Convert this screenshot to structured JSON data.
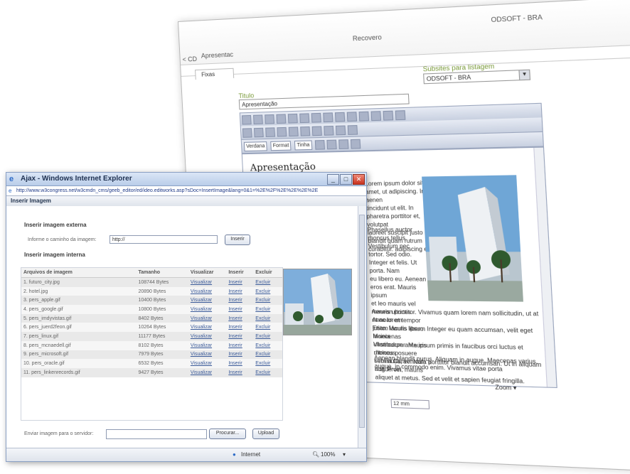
{
  "background_window": {
    "top_label": "ODSOFT - BRA",
    "center_label": "Recovero",
    "left_label_1": "< CD",
    "left_label_2": "Apresentac",
    "tab_label": "Fixas",
    "select_caption": "Subsites para listagem",
    "select_value": "ODSOFT - BRA",
    "title_caption": "Titulo",
    "title_value": "Apresentação",
    "font_select": "Verdana",
    "format_select": "Format",
    "size_select": "Tinha",
    "content_heading": "Apresentação",
    "para1": [
      "Lorem ipsum dolor sit amet, ut adipiscing. In aenen",
      "tincidunt ut elit. In pharetra porttitor et, volutpat",
      "laoreet suscipit justo blandit quam rutrum",
      "curabitur. adipiscing et"
    ],
    "para2": [
      "Phasellus auctor rhoncus tellus. Vestibulum nec",
      "tortor. Sed odio. Integer et felis. Ut porta. Nam",
      "eu libero eu. Aenean eros erat. Mauris ipsum",
      "et leo mauris vel mauris ultrices",
      "Aenean et tempor justo. Mauris ipsum",
      "Maecenas ullamcorper. Mauris rhoncus",
      "sem nulla, vehicula a augue vel, mauris"
    ],
    "para3": [
      "Aenean porttitor. Vivamus quam lorem nam sollicitudin, ut at et ac lorem",
      "Etiam iaculis libero. Integer eu quam accumsan, velit eget lacinia",
      "Vestibulum ante ipsum primis in faucibus orci luctus et ultrices posuere",
      "cubilia Curae. Nam porttitor blandit accumsan. Ut in aliquam nisl. Proin",
      "aliquet at metus. Sed et velit et sapien feugiat fringilla."
    ],
    "para4": [
      "Aenean blandit purus. Aliquam in augue. Maecenas varius,",
      "augue, in commodo enim. Vivamus vitae porta"
    ],
    "zoom_label": "Zoom ▾",
    "lower_field": "12 mm"
  },
  "popup": {
    "title": "Ajax - Windows Internet Explorer",
    "address": "http://www.w3congress.net/w3cmdn_cms/geeb_editor/ed/ideo.editworks.asp?sDoc=InsertImage&lang=0&1=%2E%2F%2E%2E%2E%2E",
    "header": "Inserir Imagem",
    "external_section": "Inserir imagem externa",
    "external_label": "Informe o caminho da imagem:",
    "external_value": "http://",
    "insert_button": "Inserir",
    "internal_section": "Inserir imagem interna",
    "columns": [
      "Arquivos de imagem",
      "Tamanho",
      "Visualizar",
      "Inserir",
      "Excluir"
    ],
    "rows": [
      {
        "file": "1. futuro_city.jpg",
        "size": "108744 Bytes",
        "view": "Visualizar",
        "insert": "Inserir",
        "delete": "Excluir"
      },
      {
        "file": "2. hotel.jpg",
        "size": "20890 Bytes",
        "view": "Visualizar",
        "insert": "Inserir",
        "delete": "Excluir"
      },
      {
        "file": "3. pers_apple.gif",
        "size": "10400 Bytes",
        "view": "Visualizar",
        "insert": "Inserir",
        "delete": "Excluir"
      },
      {
        "file": "4. pers_google.gif",
        "size": "10800 Bytes",
        "view": "Visualizar",
        "insert": "Inserir",
        "delete": "Excluir"
      },
      {
        "file": "5. pers_imdyvistas.gif",
        "size": "8402 Bytes",
        "view": "Visualizar",
        "insert": "Inserir",
        "delete": "Excluir"
      },
      {
        "file": "6. pers_juerd2feon.gif",
        "size": "10264 Bytes",
        "view": "Visualizar",
        "insert": "Inserir",
        "delete": "Excluir"
      },
      {
        "file": "7. pers_linux.gif",
        "size": "11177 Bytes",
        "view": "Visualizar",
        "insert": "Inserir",
        "delete": "Excluir"
      },
      {
        "file": "8. pers_mcnaedell.gif",
        "size": "8102 Bytes",
        "view": "Visualizar",
        "insert": "Inserir",
        "delete": "Excluir"
      },
      {
        "file": "9. pers_microsoft.gif",
        "size": "7979 Bytes",
        "view": "Visualizar",
        "insert": "Inserir",
        "delete": "Excluir"
      },
      {
        "file": "10. pers_oracle.gif",
        "size": "6532 Bytes",
        "view": "Visualizar",
        "insert": "Inserir",
        "delete": "Excluir"
      },
      {
        "file": "11. pers_linkenrecords.gif",
        "size": "9427 Bytes",
        "view": "Visualizar",
        "insert": "Inserir",
        "delete": "Excluir"
      }
    ],
    "upload_label": "Enviar imagem para o servidor:",
    "browse_button": "Procurar...",
    "upload_button": "Upload",
    "status_zone": "Internet",
    "status_zoom": "100%"
  }
}
